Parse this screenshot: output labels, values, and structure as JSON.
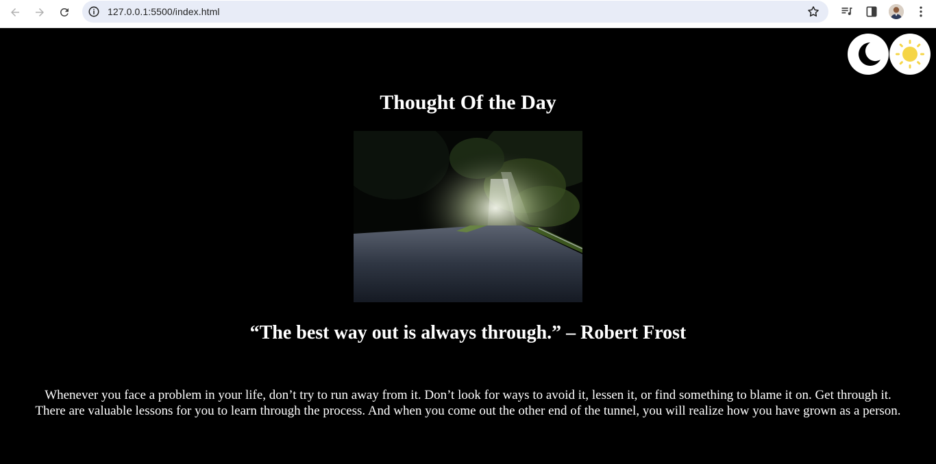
{
  "browser": {
    "url": "127.0.0.1:5500/index.html",
    "icons": [
      "back-icon",
      "forward-icon",
      "reload-icon",
      "site-info-icon",
      "bookmark-star-icon",
      "media-controls-icon",
      "side-panel-icon",
      "profile-avatar",
      "menu-kebab-icon"
    ]
  },
  "page": {
    "title": "Thought Of the Day",
    "quote": "“The best way out is always through.” – Robert Frost",
    "paragraph": "Whenever you face a problem in your life, don’t try to run away from it. Don’t look for ways to avoid it, lessen it, or find something to blame it on. Get through it. There are valuable lessons for you to learn through the process. And when you come out the other end of the tunnel, you will realize how you have grown as a person.",
    "theme_buttons": [
      "moon-icon",
      "sun-icon"
    ],
    "image": "forest-road-photo"
  },
  "colors": {
    "background": "#000000",
    "text": "#ffffff",
    "sun": "#f5d547",
    "omnibox": "#e8ecf7"
  }
}
